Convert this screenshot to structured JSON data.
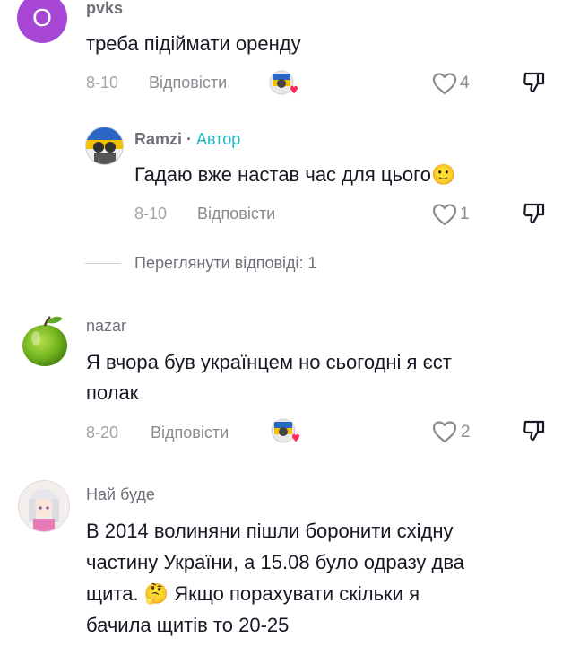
{
  "comments": [
    {
      "avatar_letter": "O",
      "username": "pvks",
      "text": "треба підіймати оренду",
      "date": "8-10",
      "reply_label": "Відповісти",
      "likes": "4"
    },
    {
      "username": "Ramzi",
      "separator": "·",
      "author_badge": "Автор",
      "text": "Гадаю вже настав час для цього",
      "emoji": "🙂",
      "date": "8-10",
      "reply_label": "Відповісти",
      "likes": "1"
    },
    {
      "username": "nazar",
      "text_line1": "Я вчора був українцем но сьогодні я єст",
      "text_line2": "полак",
      "date": "8-20",
      "reply_label": "Відповісти",
      "likes": "2"
    },
    {
      "username": "Най буде",
      "text_line1": "В 2014 волиняни пішли боронити східну",
      "text_line2": "частину України, а 15.08 було одразу два",
      "text_line3a": "щита.",
      "emoji": "🤔",
      "text_line3b": "Якщо порахувати скільки я",
      "text_line4": "бачила щитів то 20-25"
    }
  ],
  "view_replies": "Переглянути відповіді: 1",
  "colors": {
    "letter_avatar": "#a847d6",
    "author_badge": "#23b8c8",
    "heart_red": "#fe2c55"
  },
  "icons": {
    "like": "heart-outline-icon",
    "dislike": "thumbs-down-icon",
    "creator_liked": "creator-avatar-with-heart-icon"
  }
}
